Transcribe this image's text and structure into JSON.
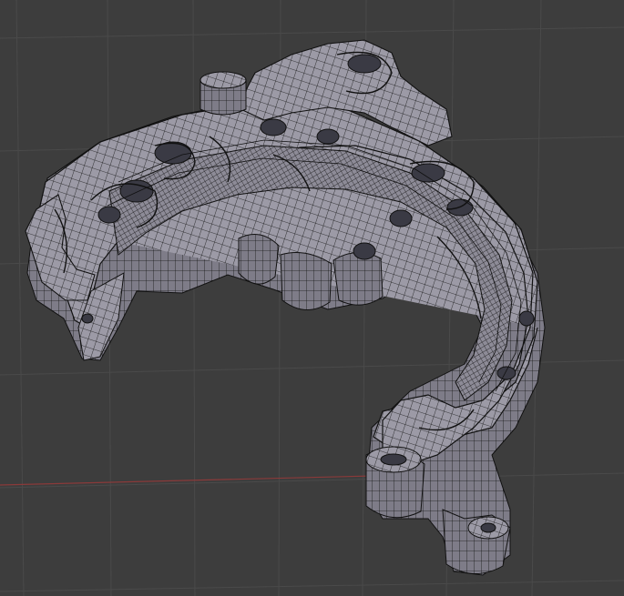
{
  "viewport": {
    "background_color": "#3d3d3d",
    "grid_color": "#4a4a4a",
    "x_axis_color": "#8a3a3a",
    "mesh_fill_color": "#9c9aa6",
    "mesh_shade_color": "#6f6d79",
    "wire_color": "#111111"
  }
}
